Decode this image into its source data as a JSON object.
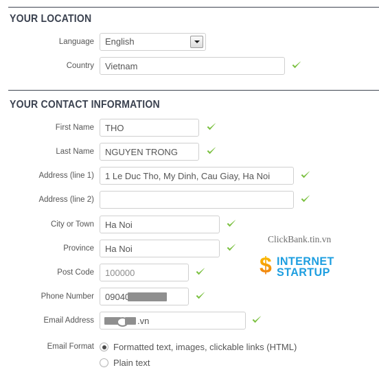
{
  "sections": [
    {
      "title": "YOUR LOCATION"
    },
    {
      "title": "YOUR CONTACT INFORMATION"
    }
  ],
  "location": {
    "language": {
      "label": "Language",
      "value": "English",
      "options": [
        "English"
      ],
      "icon": "chevron-down-icon"
    },
    "country": {
      "label": "Country",
      "value": "Vietnam",
      "placeholder": "Country",
      "valid": true
    }
  },
  "contact": {
    "first_name": {
      "label": "First Name",
      "value": "THO",
      "placeholder": "First Name",
      "valid": true
    },
    "last_name": {
      "label": "Last Name",
      "value": "NGUYEN TRONG",
      "placeholder": "Last Name",
      "valid": true
    },
    "address1": {
      "label": "Address (line 1)",
      "value": "1 Le Duc Tho, My Dinh, Cau Giay, Ha Noi",
      "placeholder": "Address (line 1)",
      "valid": true
    },
    "address2": {
      "label": "Address (line 2)",
      "value": "",
      "placeholder": "",
      "valid": true
    },
    "city": {
      "label": "City or Town",
      "value": "Ha Noi",
      "placeholder": "City or Town",
      "valid": true
    },
    "province": {
      "label": "Province",
      "value": "Ha Noi",
      "placeholder": "Province",
      "valid": true
    },
    "post_code": {
      "label": "Post Code",
      "value": "100000",
      "placeholder": "Post Code",
      "valid": true
    },
    "phone": {
      "label": "Phone Number",
      "value": "09040",
      "placeholder": "Phone Number",
      "valid": true,
      "redacted": true
    },
    "email": {
      "label": "Email Address",
      "value": ".vn",
      "placeholder": "Email Address",
      "valid": true,
      "redacted": true
    },
    "email_format": {
      "label": "Email Format",
      "options": [
        {
          "label": "Formatted text, images, clickable links (HTML)",
          "selected": true
        },
        {
          "label": "Plain text",
          "selected": false
        }
      ]
    }
  },
  "watermark": {
    "site": "ClickBank.tin.vn",
    "logo_symbol": "$",
    "logo_line1": "INTERNET",
    "logo_line2": "STARTUP"
  },
  "colors": {
    "valid_tick": "#7cc142",
    "heading": "#3b4250",
    "field_border": "#cfcfcf",
    "logo_blue": "#1d9ee0",
    "logo_orange": "#f5a310"
  }
}
